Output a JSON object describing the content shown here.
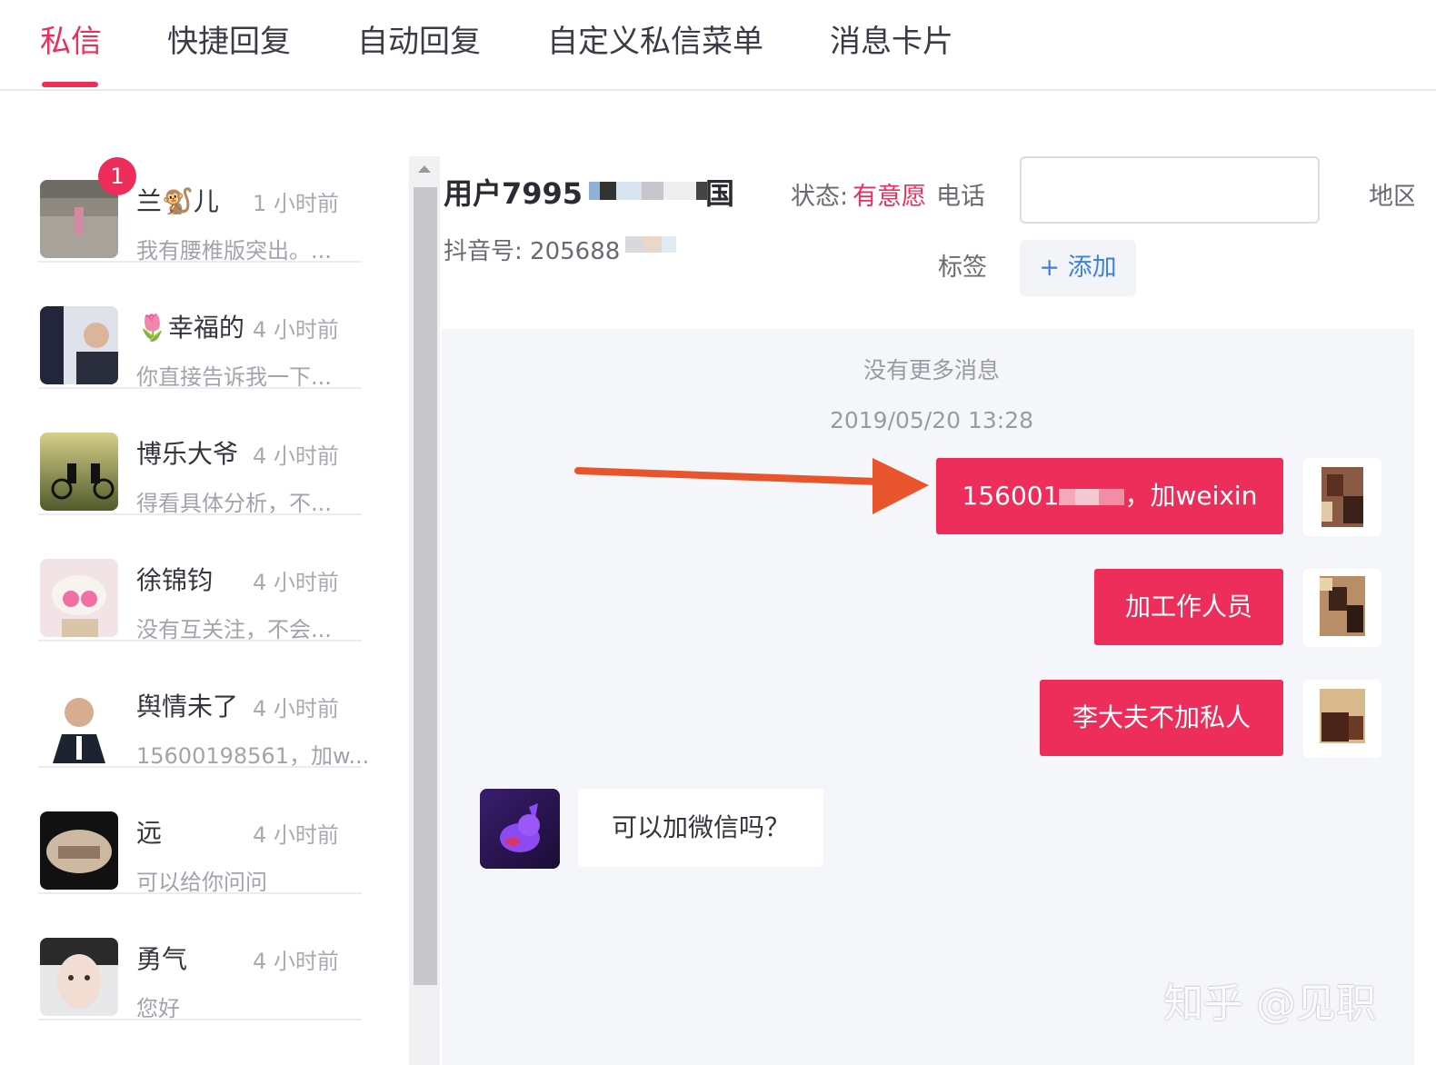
{
  "tabs": [
    {
      "label": "私信",
      "active": true
    },
    {
      "label": "快捷回复",
      "active": false
    },
    {
      "label": "自动回复",
      "active": false
    },
    {
      "label": "自定义私信菜单",
      "active": false
    },
    {
      "label": "消息卡片",
      "active": false
    }
  ],
  "conversations": [
    {
      "name": "兰🐒儿",
      "time": "1 小时前",
      "preview": "我有腰椎版突出。...",
      "unread": "1"
    },
    {
      "name": "🌷幸福的",
      "time": "4 小时前",
      "preview": "你直接告诉我一下..."
    },
    {
      "name": "博乐大爷",
      "time": "4 小时前",
      "preview": "得看具体分析，不..."
    },
    {
      "name": "徐锦钧",
      "time": "4 小时前",
      "preview": "没有互关注，不会..."
    },
    {
      "name": "舆情未了",
      "time": "4 小时前",
      "preview": "15600198561，加w..."
    },
    {
      "name": "远",
      "time": "4 小时前",
      "preview": "可以给你问问"
    },
    {
      "name": "勇气",
      "time": "4 小时前",
      "preview": "您好"
    }
  ],
  "profile": {
    "user_name": "用户7995",
    "user_name_tail": "国",
    "status_label": "状态:",
    "status_value": "有意愿",
    "phone_label": "电话",
    "phone_value": "",
    "region_label": "地区",
    "douyin_label": "抖音号: 205688",
    "tag_label": "标签",
    "add_tag_label": "+ 添加"
  },
  "chat": {
    "no_more": "没有更多消息",
    "timestamp": "2019/05/20 13:28",
    "outgoing": [
      {
        "prefix": "156001",
        "suffix": "，加weixin"
      },
      {
        "text": "加工作人员"
      },
      {
        "text": "李大夫不加私人"
      }
    ],
    "incoming": [
      {
        "text": "可以加微信吗？"
      }
    ]
  },
  "colors": {
    "accent": "#ee2e5a",
    "link": "#3d7fe6",
    "arrow": "#e8542c",
    "chat_bg": "#f5f6f9"
  },
  "watermark": "知乎 @见职"
}
